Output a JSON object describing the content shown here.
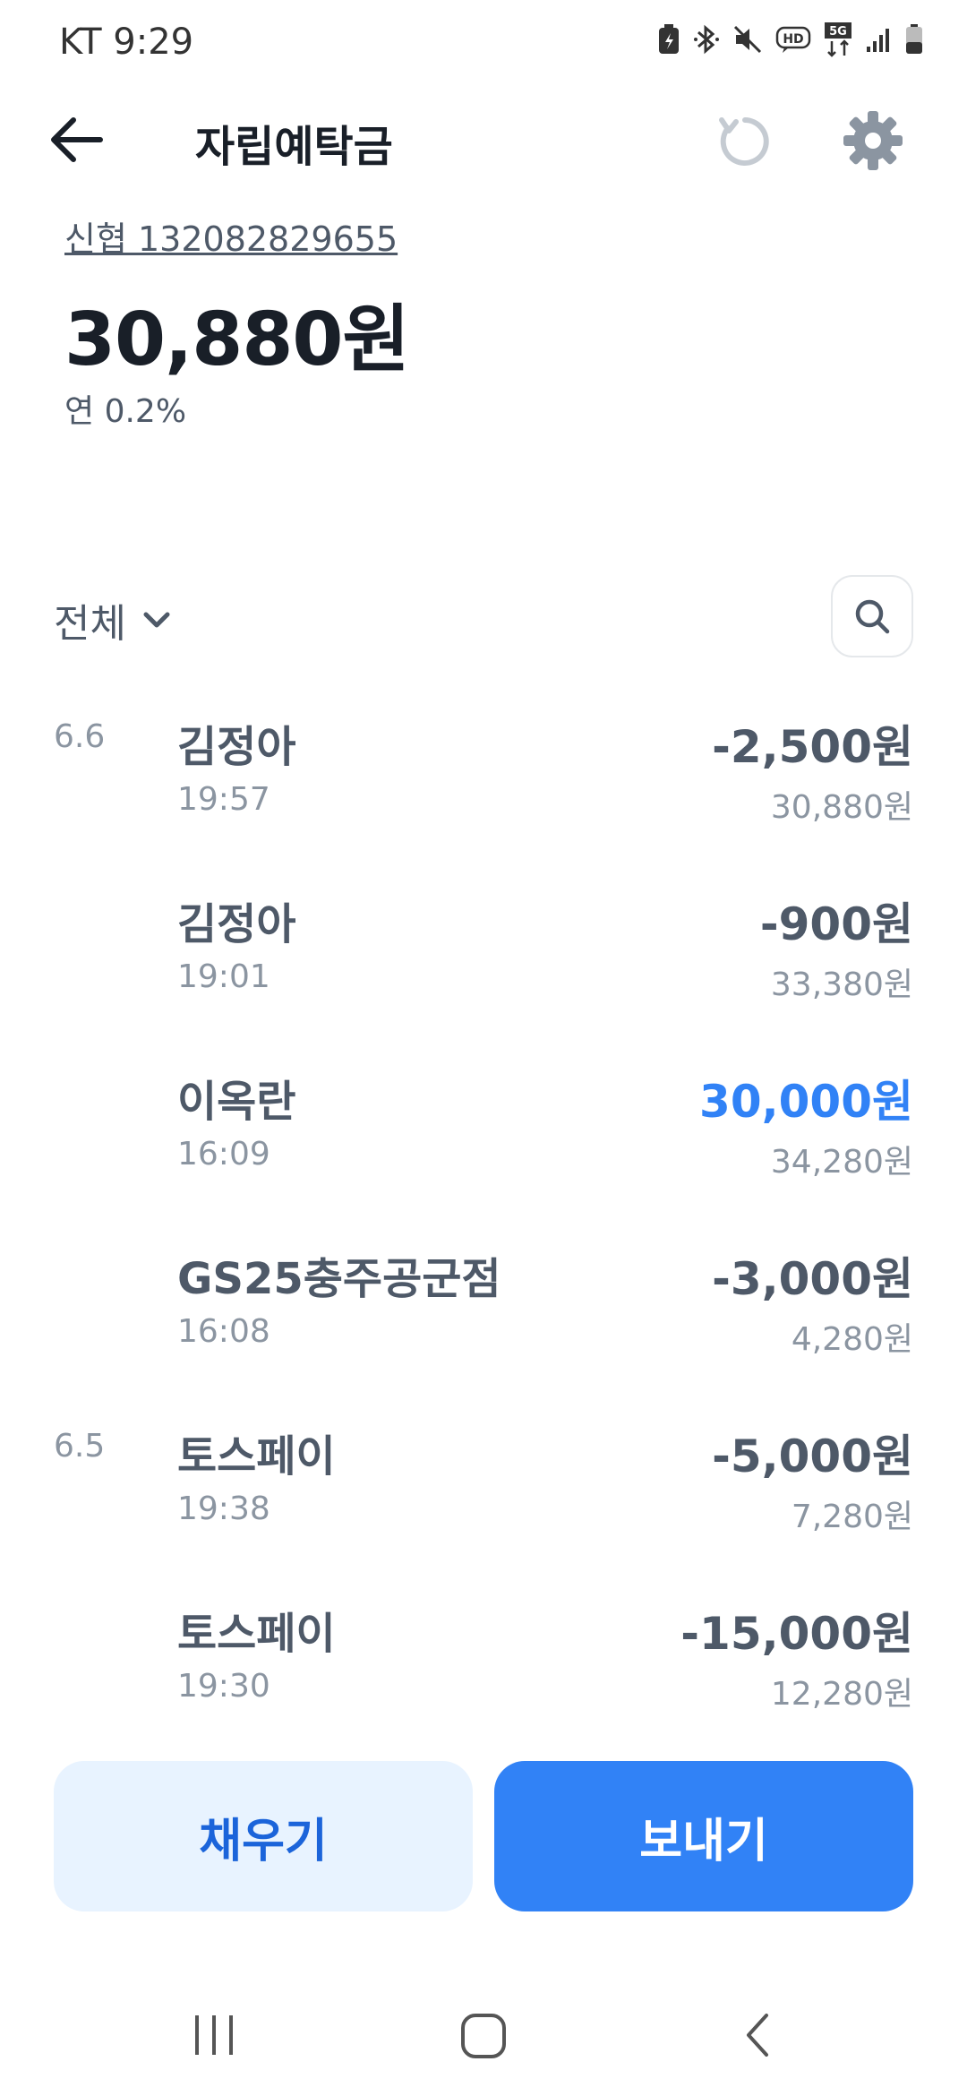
{
  "status_bar": {
    "carrier_time": "KT 9:29",
    "icons": [
      "battery-saver-icon",
      "bluetooth-icon",
      "mute-icon",
      "hd-voice-icon",
      "5g-icon",
      "signal-icon",
      "battery-icon"
    ],
    "hd_label": "HD",
    "fiveg_label": "5G"
  },
  "header": {
    "title": "자립예탁금",
    "back_icon": "arrow-left-icon",
    "refresh_icon": "refresh-icon",
    "settings_icon": "gear-icon"
  },
  "account": {
    "number": "신협 132082829655",
    "balance": "30,880원",
    "interest": "연 0.2%"
  },
  "filter": {
    "label": "전체",
    "icon": "chevron-down-icon",
    "search_icon": "search-icon"
  },
  "transactions": [
    {
      "date": "6.6",
      "name": "김정아",
      "time": "19:57",
      "amount": "-2,500원",
      "balance": "30,880원",
      "type": "debit"
    },
    {
      "date": "",
      "name": "김정아",
      "time": "19:01",
      "amount": "-900원",
      "balance": "33,380원",
      "type": "debit"
    },
    {
      "date": "",
      "name": "이옥란",
      "time": "16:09",
      "amount": "30,000원",
      "balance": "34,280원",
      "type": "credit"
    },
    {
      "date": "",
      "name": "GS25충주공군점",
      "time": "16:08",
      "amount": "-3,000원",
      "balance": "4,280원",
      "type": "debit"
    },
    {
      "date": "6.5",
      "name": "토스페이",
      "time": "19:38",
      "amount": "-5,000원",
      "balance": "7,280원",
      "type": "debit"
    },
    {
      "date": "",
      "name": "토스페이",
      "time": "19:30",
      "amount": "-15,000원",
      "balance": "12,280원",
      "type": "debit"
    }
  ],
  "actions": {
    "fill_label": "채우기",
    "send_label": "보내기"
  },
  "colors": {
    "primary": "#3182f6",
    "primary_light": "#e8f3ff",
    "text_dark": "#191f28",
    "text_mid": "#4e5968",
    "text_light": "#8b95a1"
  },
  "nav": {
    "recent_icon": "recent-apps-icon",
    "home_icon": "home-icon",
    "back_icon": "back-icon"
  }
}
